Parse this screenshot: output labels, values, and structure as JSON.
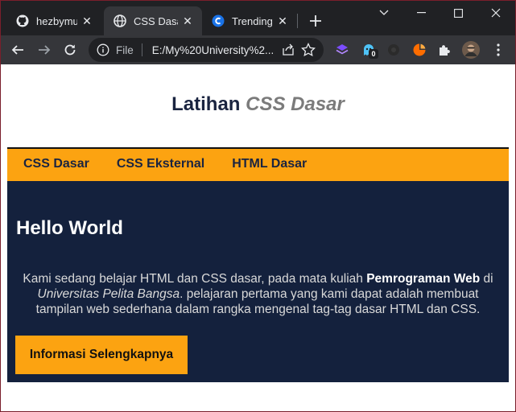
{
  "browser": {
    "tabs": [
      {
        "title": "hezbymuh",
        "favicon": "github-icon",
        "active": false
      },
      {
        "title": "CSS Dasar",
        "favicon": "globe-icon",
        "active": true
      },
      {
        "title": "Trending C",
        "favicon": "coding-site-icon",
        "active": false
      }
    ],
    "address": {
      "scheme_label": "File",
      "url": "E:/My%20University%2..."
    },
    "extensions": [
      {
        "name": "layers-extension-icon",
        "color": "#7c4dff"
      },
      {
        "name": "ghost-extension-icon",
        "badge": "0",
        "color": "#4fc3f7"
      },
      {
        "name": "dark-extension-icon",
        "color": "#2b2b2b"
      },
      {
        "name": "colorful-extension-icon",
        "color": "#ff6d00"
      },
      {
        "name": "puzzle-extensions-icon",
        "color": "#e8eaed"
      }
    ]
  },
  "site": {
    "title_plain": "Latihan",
    "title_accent": "CSS Dasar",
    "nav": [
      "CSS Dasar",
      "CSS Eksternal",
      "HTML Dasar"
    ],
    "hero": {
      "heading": "Hello World",
      "p_text1": "Kami sedang belajar HTML dan CSS dasar, pada mata kuliah ",
      "p_bold": "Pemrograman Web",
      "p_text2": " di ",
      "p_italic": "Universitas Pelita Bangsa",
      "p_text3": ". pelajaran pertama yang kami dapat adalah membuat tampilan web sederhana dalam rangka mengenal tag-tag dasar HTML dan CSS.",
      "button_label": "Informasi Selengkapnya"
    }
  },
  "colors": {
    "accent": "#fca311",
    "navy": "#14213d",
    "chrome_dark": "#202124",
    "chrome_mid": "#35363a"
  }
}
